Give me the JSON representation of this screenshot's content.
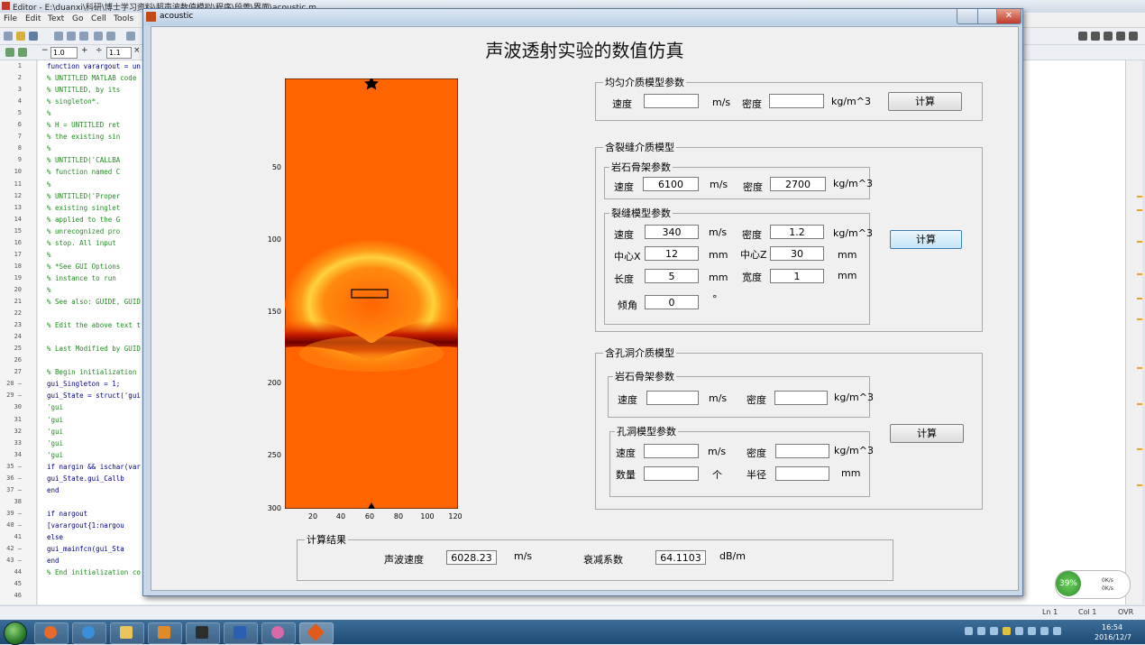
{
  "editor": {
    "title": "Editor - E:\\duanxi\\科研\\博士学习资料\\超声波数值模拟\\程序\\段蕾\\界面\\acoustic.m",
    "menu": [
      "File",
      "Edit",
      "Text",
      "Go",
      "Cell",
      "Tools"
    ],
    "toolbar": {
      "minus": "−",
      "field1": "1.0",
      "plus": "+",
      "div": "÷",
      "field2": "1.1",
      "mult": "×"
    },
    "lines": [
      {
        "n": "1",
        "t": "function varargout = un",
        "kw": true
      },
      {
        "n": "2",
        "t": "% UNTITLED MATLAB code"
      },
      {
        "n": "3",
        "t": "%      UNTITLED, by its"
      },
      {
        "n": "4",
        "t": "%      singleton*."
      },
      {
        "n": "5",
        "t": "%"
      },
      {
        "n": "6",
        "t": "%      H = UNTITLED ret"
      },
      {
        "n": "7",
        "t": "%      the existing sin"
      },
      {
        "n": "8",
        "t": "%"
      },
      {
        "n": "9",
        "t": "%      UNTITLED('CALLBA"
      },
      {
        "n": "10",
        "t": "%      function named C"
      },
      {
        "n": "11",
        "t": "%"
      },
      {
        "n": "12",
        "t": "%      UNTITLED('Proper"
      },
      {
        "n": "13",
        "t": "%      existing singlet"
      },
      {
        "n": "14",
        "t": "%      applied to the G"
      },
      {
        "n": "15",
        "t": "%      unrecognized pro"
      },
      {
        "n": "16",
        "t": "%      stop.  All input"
      },
      {
        "n": "17",
        "t": "%"
      },
      {
        "n": "18",
        "t": "%      *See GUI Options"
      },
      {
        "n": "19",
        "t": "%      instance to run"
      },
      {
        "n": "20",
        "t": "%"
      },
      {
        "n": "21",
        "t": "% See also: GUIDE, GUID"
      },
      {
        "n": "22",
        "t": ""
      },
      {
        "n": "23",
        "t": "% Edit the above text t"
      },
      {
        "n": "24",
        "t": ""
      },
      {
        "n": "25",
        "t": "% Last Modified by GUID"
      },
      {
        "n": "26",
        "t": ""
      },
      {
        "n": "27",
        "t": "% Begin initialization"
      },
      {
        "n": "28 –",
        "t": "gui_Singleton = 1;",
        "kw": true
      },
      {
        "n": "29 –",
        "t": "gui_State = struct('gui",
        "kw": true
      },
      {
        "n": "30",
        "t": "                   'gui"
      },
      {
        "n": "31",
        "t": "                   'gui"
      },
      {
        "n": "32",
        "t": "                   'gui"
      },
      {
        "n": "33",
        "t": "                   'gui"
      },
      {
        "n": "34",
        "t": "                   'gui"
      },
      {
        "n": "35 –",
        "t": "if nargin && ischar(var",
        "kw": true
      },
      {
        "n": "36 –",
        "t": "    gui_State.gui_Callb",
        "kw": true
      },
      {
        "n": "37 –",
        "t": "end",
        "kw": true
      },
      {
        "n": "38",
        "t": ""
      },
      {
        "n": "39 –",
        "t": "if nargout",
        "kw": true
      },
      {
        "n": "40 –",
        "t": "    [varargout{1:nargou",
        "kw": true
      },
      {
        "n": "41",
        "t": "else",
        "kw": true
      },
      {
        "n": "42 –",
        "t": "    gui_mainfcn(gui_Sta",
        "kw": true
      },
      {
        "n": "43 –",
        "t": "end",
        "kw": true
      },
      {
        "n": "44",
        "t": "% End initialization co"
      },
      {
        "n": "45",
        "t": ""
      },
      {
        "n": "46",
        "t": ""
      }
    ],
    "status": {
      "ln": "Ln  1",
      "col": "Col  1",
      "ovr": "OVR"
    }
  },
  "taskbar": {
    "time": "16:54",
    "date": "2016/12/7"
  },
  "network": {
    "percent": "39%",
    "up": "0K/s",
    "down": "0K/s"
  },
  "figure": {
    "window_title": "acoustic",
    "close_glyph": "✕",
    "main_title": "声波透射实验的数值仿真",
    "plot": {
      "yticks": [
        "50",
        "100",
        "150",
        "200",
        "250",
        "300"
      ],
      "xticks": [
        "20",
        "40",
        "60",
        "80",
        "100",
        "120"
      ],
      "x_range": [
        0,
        123
      ],
      "y_range": [
        0,
        300
      ]
    },
    "uniform": {
      "title": "均匀介质模型参数",
      "speed_label": "速度",
      "speed_unit": "m/s",
      "speed_value": "",
      "density_label": "密度",
      "density_unit": "kg/m^3",
      "density_value": "",
      "calc_button": "计算"
    },
    "crack": {
      "title": "含裂缝介质模型",
      "rock_title": "岩石骨架参数",
      "rock_speed_label": "速度",
      "rock_speed_value": "6100",
      "rock_speed_unit": "m/s",
      "rock_density_label": "密度",
      "rock_density_value": "2700",
      "rock_density_unit": "kg/m^3",
      "fracture_title": "裂缝模型参数",
      "f_speed_label": "速度",
      "f_speed_value": "340",
      "f_speed_unit": "m/s",
      "f_density_label": "密度",
      "f_density_value": "1.2",
      "f_density_unit": "kg/m^3",
      "cx_label": "中心X",
      "cx_value": "12",
      "cx_unit": "mm",
      "cz_label": "中心Z",
      "cz_value": "30",
      "cz_unit": "mm",
      "len_label": "长度",
      "len_value": "5",
      "len_unit": "mm",
      "width_label": "宽度",
      "width_value": "1",
      "width_unit": "mm",
      "angle_label": "倾角",
      "angle_value": "0",
      "angle_unit": "°",
      "calc_button": "计算"
    },
    "hole": {
      "title": "含孔洞介质模型",
      "rock_title": "岩石骨架参数",
      "rock_speed_label": "速度",
      "rock_speed_value": "",
      "rock_speed_unit": "m/s",
      "rock_density_label": "密度",
      "rock_density_value": "",
      "rock_density_unit": "kg/m^3",
      "hole_title": "孔洞模型参数",
      "h_speed_label": "速度",
      "h_speed_value": "",
      "h_speed_unit": "m/s",
      "h_density_label": "密度",
      "h_density_value": "",
      "h_density_unit": "kg/m^3",
      "count_label": "数量",
      "count_value": "",
      "count_unit": "个",
      "radius_label": "半径",
      "radius_value": "",
      "radius_unit": "mm",
      "calc_button": "计算"
    },
    "result": {
      "title": "计算结果",
      "velocity_label": "声波速度",
      "velocity_value": "6028.23",
      "velocity_unit": "m/s",
      "attenuation_label": "衰减系数",
      "attenuation_value": "64.1103",
      "attenuation_unit": "dB/m"
    }
  }
}
